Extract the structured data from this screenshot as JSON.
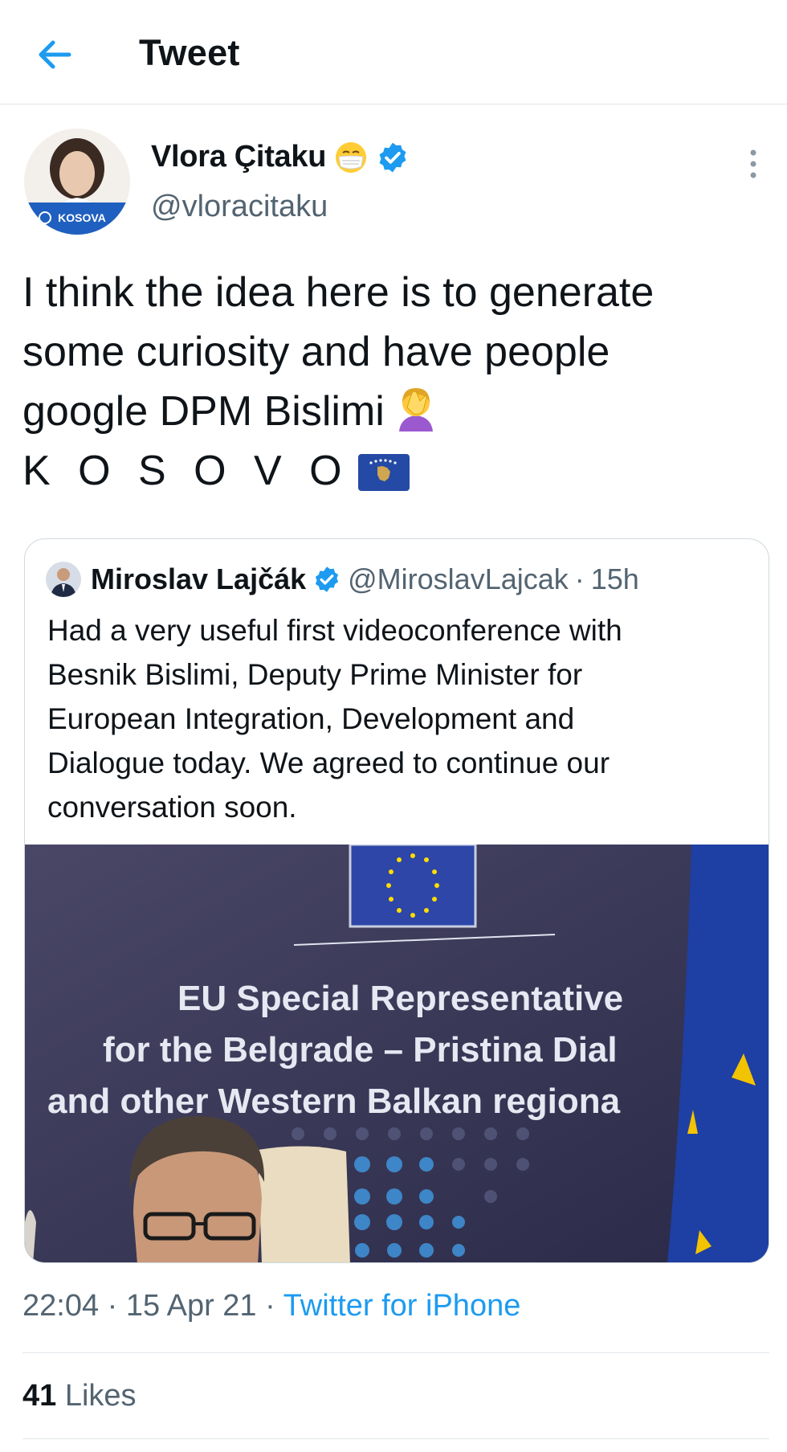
{
  "header": {
    "title": "Tweet",
    "back_icon": "arrow-left-icon",
    "accent": "#1d9bf0"
  },
  "author": {
    "name": "Vlora Çitaku",
    "handle": "@vloracitaku",
    "name_emoji": "face-with-medical-mask-icon",
    "verified_icon": "verified-badge-icon",
    "avatar_badge": "KOSOVA"
  },
  "tweet": {
    "lines": [
      "I think the idea here is to generate",
      "some curiosity and have people",
      "google DPM Bislimi",
      "K O S O V O"
    ],
    "emoji_after_line3": "woman-facepalming-icon",
    "emoji_after_line4": "kosovo-flag-icon"
  },
  "quote": {
    "name": "Miroslav Lajčák",
    "handle": "@MiroslavLajcak",
    "separator": "·",
    "time": "15h",
    "lines": [
      "Had a very useful first videoconference with",
      "Besnik Bislimi, Deputy Prime Minister for",
      "European Integration, Development and",
      "Dialogue today. We agreed to continue our",
      "conversation soon."
    ],
    "image_text": [
      "EU Special Representative",
      "for the Belgrade – Pristina Dial",
      "and other Western Balkan regiona"
    ]
  },
  "meta": {
    "time": "22:04",
    "sep1": "·",
    "date": "15 Apr 21",
    "sep2": "·",
    "source": "Twitter for iPhone"
  },
  "stats": {
    "likes_count": "41",
    "likes_label": "Likes"
  }
}
